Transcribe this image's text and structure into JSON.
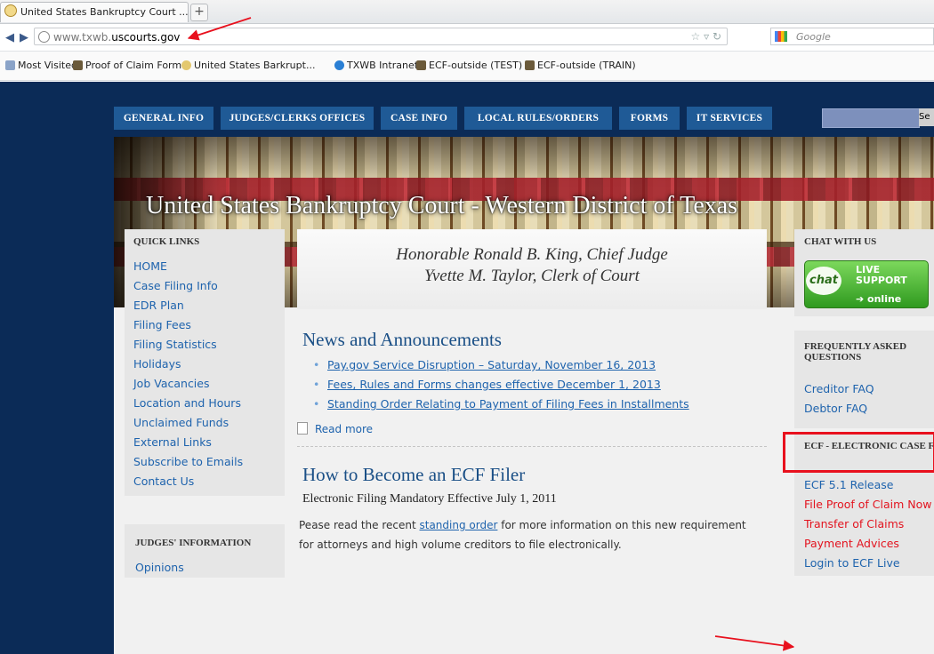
{
  "browser": {
    "tab_title": "United States Bankruptcy Court ...",
    "tab_add": "+",
    "url_prefix": "www.txwb.",
    "url_domain": "uscourts.gov",
    "search_engine": "Google",
    "bookmarks": [
      {
        "label": "Most Visited",
        "icon": "bookmark-icon"
      },
      {
        "label": "Proof of Claim Form",
        "icon": "scales-icon"
      },
      {
        "label": "United States Barkrupt...",
        "icon": "seal-icon"
      },
      {
        "label": "TXWB Intranet",
        "icon": "ie-icon"
      },
      {
        "label": "ECF-outside (TEST)",
        "icon": "scales-icon"
      },
      {
        "label": "ECF-outside (TRAIN)",
        "icon": "scales-icon"
      }
    ]
  },
  "site": {
    "nav": [
      "GENERAL INFO",
      "JUDGES/CLERKS OFFICES",
      "CASE INFO",
      "LOCAL RULES/ORDERS",
      "FORMS",
      "IT SERVICES"
    ],
    "search_button": "Se",
    "banner_title": "United States Bankruptcy Court - Western District of Texas"
  },
  "quick_links": {
    "heading": "QUICK LINKS",
    "items": [
      "HOME",
      "Case Filing Info",
      "EDR Plan",
      "Filing Fees",
      "Filing Statistics",
      "Holidays",
      "Job Vacancies",
      "Location and Hours",
      "Unclaimed Funds",
      "External Links",
      "Subscribe to Emails",
      "Contact Us"
    ]
  },
  "judges_info": {
    "heading": "JUDGES' INFORMATION",
    "link": "Opinions"
  },
  "honorable": {
    "line1": "Honorable Ronald B. King, Chief Judge",
    "line2": "Yvette M. Taylor, Clerk of Court"
  },
  "news": {
    "heading": "News and Announcements",
    "items": [
      "Pay.gov Service Disruption – Saturday, November 16, 2013",
      "Fees, Rules and Forms changes effective December 1, 2013",
      "Standing Order Relating to Payment of Filing Fees in Installments"
    ],
    "read_more": "Read more"
  },
  "ecf_filer": {
    "heading": "How to Become an ECF Filer",
    "subheading": "Electronic Filing Mandatory Effective July 1, 2011",
    "para_before": "Pease read the recent ",
    "para_link": "standing order",
    "para_after": " for more information on this new requirement",
    "para_line2": "for attorneys and high volume creditors to file electronically."
  },
  "chat": {
    "heading": "CHAT WITH US",
    "bubble": "chat",
    "live": "LIVE",
    "support": "SUPPORT",
    "online": "online"
  },
  "faq": {
    "heading": "FREQUENTLY ASKED QUESTIONS",
    "items": [
      "Creditor FAQ",
      "Debtor FAQ"
    ]
  },
  "ecf_box": {
    "heading": "ECF - ELECTRONIC CASE FILING",
    "links": [
      {
        "label": "ECF 5.1 Release",
        "color": "#1e63ad"
      },
      {
        "label": "File Proof of Claim Now",
        "color": "#e3141f"
      },
      {
        "label": "Transfer of Claims",
        "color": "#e3141f"
      },
      {
        "label": "Payment Advices",
        "color": "#e3141f"
      },
      {
        "label": "Login to ECF Live",
        "color": "#1e63ad"
      }
    ]
  },
  "colors": {
    "page_bg": "#0b2b57",
    "nav_bg": "#1f5a96",
    "link": "#1e63ad",
    "annotation_red": "#e8101d"
  }
}
